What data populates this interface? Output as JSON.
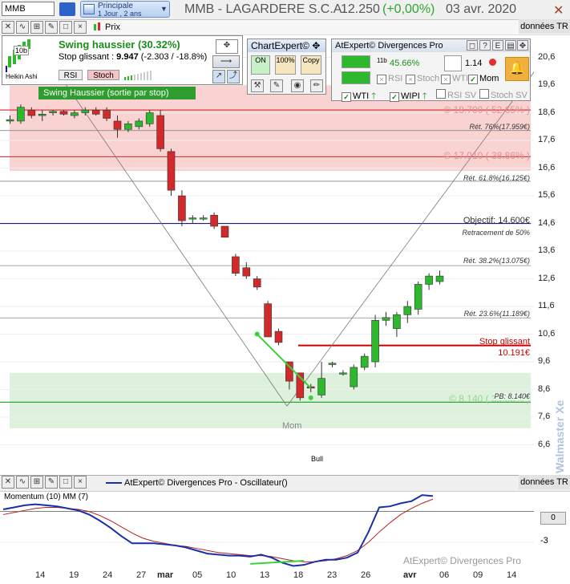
{
  "toolbar": {
    "symbol": "MMB",
    "view_title": "Principale",
    "view_sub": "1 Jour , 2 ans",
    "title": "MMB - LAGARDERE S.C.A.",
    "price": "12.250",
    "change": "(+0,00%)",
    "date": "03 avr. 2020",
    "prix_label": "Prix",
    "donnees": "données TR"
  },
  "swing_panel": {
    "title": "Swing haussier (30.32%)",
    "stop_label": "Stop glissant :",
    "stop_value": "9.947",
    "stop_delta": "(-2.303 / -18.8%)",
    "heikin_label": "Heikin Ashi",
    "rsi_btn": "RSI",
    "stoch_btn": "Stoch",
    "exit_label": "Swing Haussier (sortie par stop)",
    "badge": "10b"
  },
  "chartexpert": {
    "title": "ChartExpert©",
    "btn_on": "ON",
    "btn_100": "100%",
    "btn_copy": "Copy"
  },
  "atexpert": {
    "title": "AtExpert© Divergences Pro",
    "pct": "45.66%",
    "ratio": "1.14",
    "badge": "11b",
    "rsi": "RSI",
    "stoch": "Stoch",
    "wti": "WTI",
    "mom": "Mom",
    "wti2": "WTI",
    "wipi": "WIPI",
    "rsi_sv": "RSI SV",
    "stoch_sv": "Stoch SV"
  },
  "levels": {
    "r1": "© 18.700 ( 52.65% )",
    "r2": "© 17.010 ( 38.86% )",
    "fib76": "Rét. 76%(17.959€)",
    "fib618": "Rét. 61.8%(16.125€)",
    "objectif": "Objectif: 14.600€",
    "retr50": "Retracement de 50%",
    "fib382": "Rét. 38.2%(13.075€)",
    "fib236": "Rét. 23.6%(11.189€)",
    "stop_label": "Stop glissant",
    "stop_value": "10.191€",
    "support": "© 8.140 ( 33.55% )",
    "pb": "PB: 8.140€"
  },
  "annotations": {
    "mom": "Mom",
    "bull": "Bull"
  },
  "oscillator": {
    "title": "AtExpert© Divergences Pro - Oscillateur()",
    "legend": "Momentum (10) MM (7)",
    "zero_label": "0",
    "neg3_label": "-3",
    "donnees": "données TR"
  },
  "watermark": "Walmaster Xe",
  "footer_brand": "AtExpert© Divergences Pro",
  "colors": {
    "up": "#2eb82e",
    "down": "#d22a2a",
    "resistance_band": "#f7c7c7",
    "support_band": "#d9f0d9",
    "stop_line": "#cc0000",
    "momentum": "#1a2fa8",
    "mm": "#b22222"
  },
  "chart_data": {
    "type": "candlestick",
    "x_labels": [
      "14",
      "19",
      "24",
      "27",
      "mar",
      "05",
      "10",
      "13",
      "18",
      "23",
      "26",
      "avr",
      "06",
      "09",
      "14"
    ],
    "y_ticks": [
      "20,6",
      "19,6",
      "18,6",
      "17,6",
      "16,6",
      "15,6",
      "14,6",
      "13,6",
      "12,6",
      "11,6",
      "10,6",
      "9,6",
      "8,6",
      "7,6",
      "6,6"
    ],
    "ylim": [
      5.6,
      21.4
    ],
    "candles": [
      {
        "o": 18.3,
        "h": 18.5,
        "l": 18.2,
        "c": 18.35
      },
      {
        "o": 18.3,
        "h": 18.9,
        "l": 18.2,
        "c": 18.8
      },
      {
        "o": 18.7,
        "h": 18.8,
        "l": 18.4,
        "c": 18.5
      },
      {
        "o": 18.5,
        "h": 18.7,
        "l": 18.3,
        "c": 18.55
      },
      {
        "o": 18.6,
        "h": 18.7,
        "l": 18.5,
        "c": 18.65
      },
      {
        "o": 18.65,
        "h": 18.7,
        "l": 18.5,
        "c": 18.55
      },
      {
        "o": 18.5,
        "h": 18.7,
        "l": 18.4,
        "c": 18.6
      },
      {
        "o": 18.6,
        "h": 18.8,
        "l": 18.5,
        "c": 18.7
      },
      {
        "o": 18.7,
        "h": 18.8,
        "l": 18.5,
        "c": 18.55
      },
      {
        "o": 18.7,
        "h": 18.8,
        "l": 18.3,
        "c": 18.4
      },
      {
        "o": 18.3,
        "h": 18.5,
        "l": 17.7,
        "c": 18.0
      },
      {
        "o": 18.0,
        "h": 18.3,
        "l": 17.9,
        "c": 18.2
      },
      {
        "o": 18.1,
        "h": 18.4,
        "l": 18.0,
        "c": 18.3
      },
      {
        "o": 18.2,
        "h": 18.7,
        "l": 18.1,
        "c": 18.6
      },
      {
        "o": 18.5,
        "h": 18.7,
        "l": 17.2,
        "c": 17.3
      },
      {
        "o": 17.2,
        "h": 17.3,
        "l": 15.6,
        "c": 15.8
      },
      {
        "o": 15.6,
        "h": 15.8,
        "l": 14.5,
        "c": 14.7
      },
      {
        "o": 14.8,
        "h": 14.9,
        "l": 14.6,
        "c": 14.8
      },
      {
        "o": 14.8,
        "h": 14.9,
        "l": 14.7,
        "c": 14.8
      },
      {
        "o": 14.9,
        "h": 15.0,
        "l": 14.4,
        "c": 14.5
      },
      {
        "o": 14.5,
        "h": 14.5,
        "l": 14.1,
        "c": 14.1
      },
      {
        "o": 13.4,
        "h": 13.5,
        "l": 12.7,
        "c": 12.8
      },
      {
        "o": 13.0,
        "h": 13.2,
        "l": 12.6,
        "c": 12.7
      },
      {
        "o": 12.6,
        "h": 12.7,
        "l": 12.2,
        "c": 12.3
      },
      {
        "o": 11.7,
        "h": 11.8,
        "l": 10.5,
        "c": 10.5
      },
      {
        "o": 10.7,
        "h": 10.8,
        "l": 10.2,
        "c": 10.3
      },
      {
        "o": 9.6,
        "h": 9.6,
        "l": 8.6,
        "c": 8.9
      },
      {
        "o": 9.2,
        "h": 9.2,
        "l": 8.2,
        "c": 8.3
      },
      {
        "o": 8.7,
        "h": 8.8,
        "l": 8.5,
        "c": 8.65
      },
      {
        "o": 8.4,
        "h": 9.6,
        "l": 8.3,
        "c": 9.0
      },
      {
        "o": 9.5,
        "h": 9.6,
        "l": 9.4,
        "c": 9.55
      },
      {
        "o": 9.2,
        "h": 9.3,
        "l": 9.1,
        "c": 9.2
      },
      {
        "o": 8.7,
        "h": 9.5,
        "l": 8.6,
        "c": 9.4
      },
      {
        "o": 9.4,
        "h": 9.9,
        "l": 9.3,
        "c": 9.8
      },
      {
        "o": 9.6,
        "h": 11.3,
        "l": 9.4,
        "c": 11.1
      },
      {
        "o": 11.1,
        "h": 11.4,
        "l": 10.9,
        "c": 11.2
      },
      {
        "o": 10.8,
        "h": 11.4,
        "l": 10.5,
        "c": 11.3
      },
      {
        "o": 11.3,
        "h": 11.8,
        "l": 11.0,
        "c": 11.6
      },
      {
        "o": 11.5,
        "h": 12.5,
        "l": 11.3,
        "c": 12.4
      },
      {
        "o": 12.4,
        "h": 12.8,
        "l": 12.2,
        "c": 12.7
      },
      {
        "o": 12.5,
        "h": 12.9,
        "l": 12.4,
        "c": 12.7
      }
    ],
    "horizontal_levels": [
      {
        "y": 18.7,
        "color": "#d23c3c"
      },
      {
        "y": 17.959,
        "color": "#888888"
      },
      {
        "y": 17.01,
        "color": "#d23c3c"
      },
      {
        "y": 16.125,
        "color": "#888888"
      },
      {
        "y": 14.6,
        "color": "#1a1a7a"
      },
      {
        "y": 13.075,
        "color": "#888888"
      },
      {
        "y": 11.189,
        "color": "#888888"
      },
      {
        "y": 8.14,
        "color": "#2ea82e"
      }
    ],
    "stop_level": 10.191,
    "resistance_band": [
      16.5,
      19.6
    ],
    "support_band": [
      7.2,
      9.2
    ],
    "momentum": [
      0.2,
      0.4,
      0.6,
      0.7,
      0.6,
      0.5,
      0.3,
      0.1,
      -0.3,
      -0.9,
      -1.6,
      -2.4,
      -3.1,
      -3.1,
      -3.1,
      -3.2,
      -3.3,
      -3.5,
      -3.8,
      -4.1,
      -4.2,
      -4.3,
      -4.3,
      -4.4,
      -4.2,
      -4.5,
      -5.0,
      -5.3,
      -5.2,
      -4.9,
      -4.7,
      -4.7,
      -4.5,
      -4.0,
      -2.0,
      0.4,
      0.5,
      0.8,
      1.0,
      1.6,
      1.5
    ],
    "mm": [
      -0.3,
      -0.1,
      0.1,
      0.3,
      0.4,
      0.4,
      0.3,
      0.2,
      0.0,
      -0.4,
      -0.9,
      -1.5,
      -2.1,
      -2.6,
      -2.9,
      -3.1,
      -3.3,
      -3.4,
      -3.6,
      -3.8,
      -4.0,
      -4.1,
      -4.2,
      -4.3,
      -4.3,
      -4.4,
      -4.6,
      -4.8,
      -4.9,
      -4.9,
      -4.8,
      -4.6,
      -4.3,
      -3.8,
      -3.0,
      -2.0,
      -1.1,
      -0.3,
      0.3,
      0.8,
      1.2
    ],
    "osc_ylim": [
      -5.5,
      2.0
    ]
  }
}
